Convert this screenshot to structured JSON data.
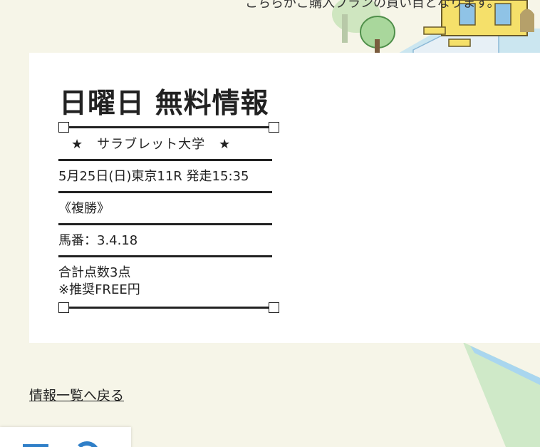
{
  "header": {
    "note": "こちらがご購入プランの買い目となります。"
  },
  "article": {
    "title": "日曜日 無料情報",
    "star_line": "★　サラブレット大学　★",
    "race": "5月25日(日)東京11R 発走15:35",
    "bet_type": "《複勝》",
    "horse_numbers": "馬番：3.4.18",
    "total_points": "合計点数3点",
    "recommend": "※推奨FREE円"
  },
  "nav": {
    "back_label": "情報一覧へ戻る"
  },
  "colors": {
    "page_bg": "#f6f5e8",
    "card_bg": "#ffffff",
    "accent_blue": "#2f7fc8",
    "illustration_green": "#9fd19b",
    "illustration_yellow": "#f5e06a"
  }
}
